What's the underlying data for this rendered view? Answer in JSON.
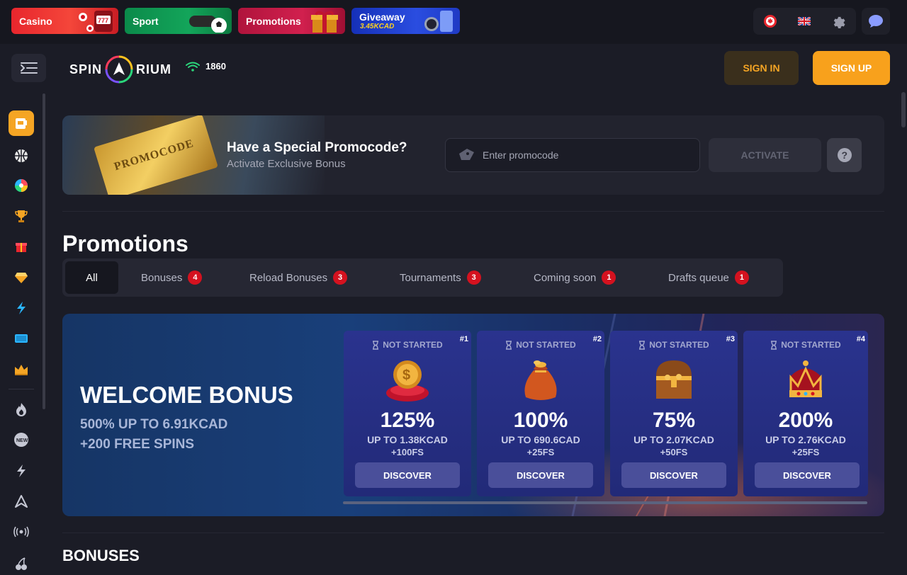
{
  "topbar": {
    "categories": [
      {
        "label": "Casino"
      },
      {
        "label": "Sport"
      },
      {
        "label": "Promotions"
      },
      {
        "label": "Giveaway",
        "sub": "3.45KCAD"
      }
    ]
  },
  "header": {
    "logo": "SPIN",
    "logo_end": "RIUM",
    "online_count": "1860",
    "sign_in": "SIGN IN",
    "sign_up": "SIGN UP"
  },
  "promocode": {
    "ticket_text": "PROMOCODE",
    "title": "Have a Special Promocode?",
    "subtitle": "Activate Exclusive Bonus",
    "placeholder": "Enter promocode",
    "activate": "ACTIVATE"
  },
  "page_title": "Promotions",
  "filters": [
    {
      "label": "All"
    },
    {
      "label": "Bonuses",
      "count": "4"
    },
    {
      "label": "Reload Bonuses",
      "count": "3"
    },
    {
      "label": "Tournaments",
      "count": "3"
    },
    {
      "label": "Coming soon",
      "count": "1"
    },
    {
      "label": "Drafts queue",
      "count": "1"
    }
  ],
  "welcome": {
    "title": "WELCOME BONUS",
    "line1": "500% UP TO 6.91KCAD",
    "line2": "+200 FREE SPINS"
  },
  "bonus_cards": [
    {
      "status": "NOT STARTED",
      "num": "#1",
      "percent": "125%",
      "upto": "UP TO 1.38KCAD",
      "fs": "+100FS",
      "button": "DISCOVER",
      "icon": "coin-on-pillow-icon"
    },
    {
      "status": "NOT STARTED",
      "num": "#2",
      "percent": "100%",
      "upto": "UP TO 690.6CAD",
      "fs": "+25FS",
      "button": "DISCOVER",
      "icon": "money-bag-icon"
    },
    {
      "status": "NOT STARTED",
      "num": "#3",
      "percent": "75%",
      "upto": "UP TO 2.07KCAD",
      "fs": "+50FS",
      "button": "DISCOVER",
      "icon": "treasure-chest-icon"
    },
    {
      "status": "NOT STARTED",
      "num": "#4",
      "percent": "200%",
      "upto": "UP TO 2.76KCAD",
      "fs": "+25FS",
      "button": "DISCOVER",
      "icon": "crown-icon"
    }
  ],
  "section_title": "BONUSES",
  "colors": {
    "accent": "#f8a11c",
    "badge": "#d4121f",
    "bg": "#1b1c26"
  }
}
